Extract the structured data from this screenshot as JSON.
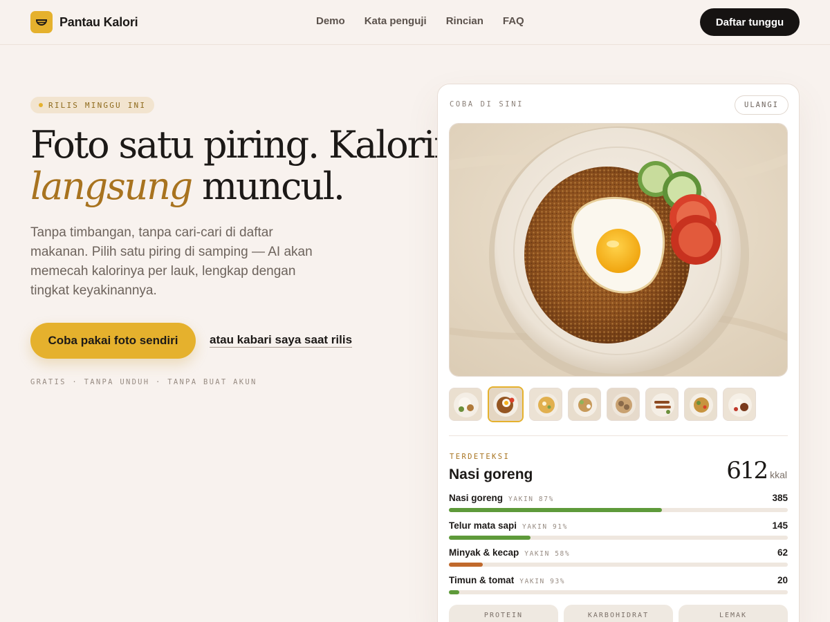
{
  "nav": {
    "brand": "Pantau Kalori",
    "links": [
      "Demo",
      "Kata penguji",
      "Rincian",
      "FAQ"
    ],
    "cta": "Daftar tunggu"
  },
  "hero": {
    "badge": "RILIS MINGGU INI",
    "headline_line1": "Foto satu piring. Kalorinya",
    "headline_em": "langsung",
    "headline_rest": " muncul.",
    "subtitle": "Tanpa timbangan, tanpa cari-cari di daftar makanan. Pilih satu piring di samping — AI akan memecah kalorinya per lauk, lengkap dengan tingkat keyakinannya.",
    "cta_primary": "Coba pakai foto sendiri",
    "cta_secondary": "atau kabari saya saat rilis",
    "footnote": "GRATIS · TANPA UNDUH · TANPA BUAT AKUN"
  },
  "demo": {
    "label": "COBA DI SINI",
    "reset": "ULANGI",
    "thumbnails": [
      "nasi-campur",
      "nasi-goreng",
      "soto",
      "gado-gado",
      "bakso",
      "sate",
      "mie-goreng",
      "rendang"
    ],
    "active_thumbnail": 1,
    "detected_label": "TERDETEKSI",
    "dish": "Nasi goreng",
    "total": "612",
    "unit": "kkal",
    "items": [
      {
        "name": "Nasi goreng",
        "conf": "YAKIN 87%",
        "kcal": "385",
        "fraction": 0.629,
        "color": "#5e9a3a"
      },
      {
        "name": "Telur mata sapi",
        "conf": "YAKIN 91%",
        "kcal": "145",
        "fraction": 0.241,
        "color": "#5e9a3a"
      },
      {
        "name": "Minyak & kecap",
        "conf": "YAKIN 58%",
        "kcal": "62",
        "fraction": 0.1,
        "color": "#c0692c"
      },
      {
        "name": "Timun & tomat",
        "conf": "YAKIN 93%",
        "kcal": "20",
        "fraction": 0.03,
        "color": "#5e9a3a"
      }
    ],
    "macros": [
      "PROTEIN",
      "KARBOHIDRAT",
      "LEMAK"
    ]
  }
}
